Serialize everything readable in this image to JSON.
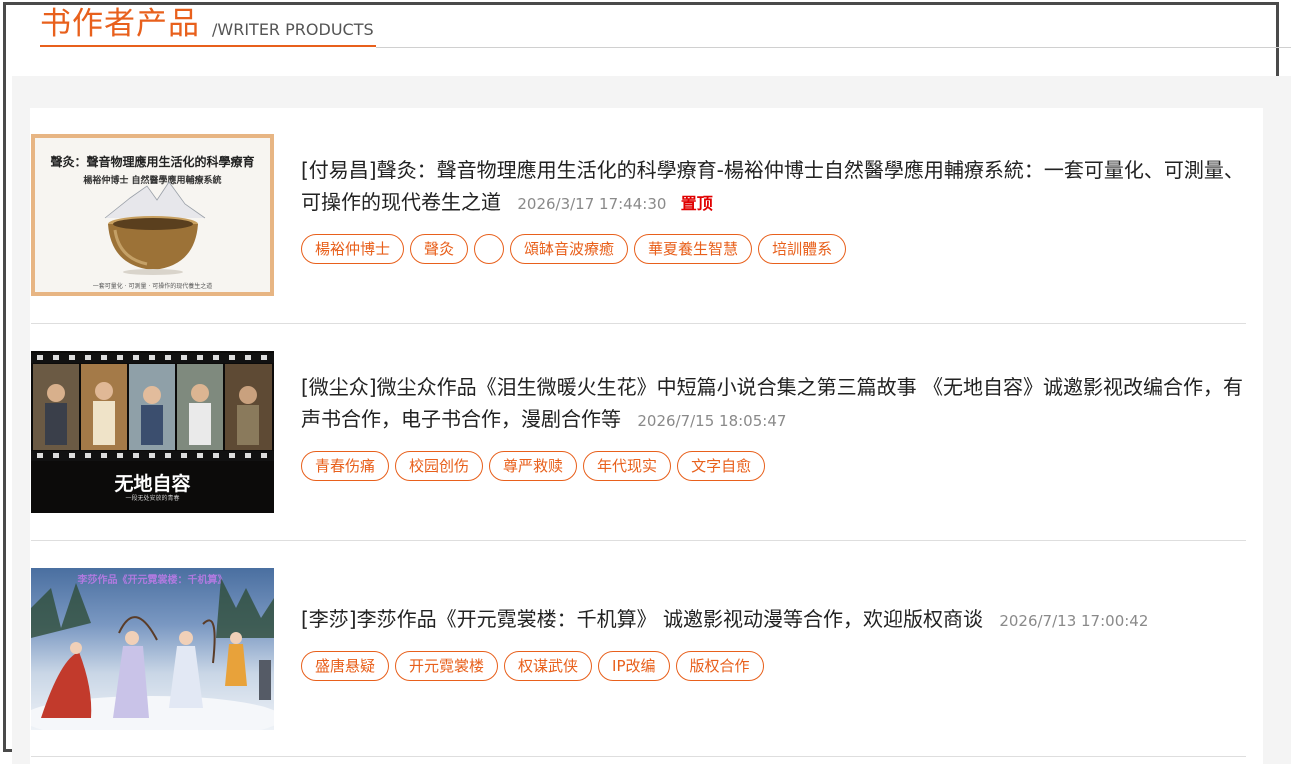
{
  "header": {
    "title_cn": "书作者产品",
    "title_en": "/WRITER PRODUCTS"
  },
  "colors": {
    "accent": "#e8601c",
    "pin": "#e00000"
  },
  "items": [
    {
      "author": "[付易昌]",
      "title": "聲灸：聲音物理應用生活化的科學療育-楊裕仲博士自然醫學應用輔療系統：一套可量化、可測量、可操作的现代卷生之道",
      "date": "2026/3/17 17:44:30",
      "pin": "置顶",
      "tags": [
        "楊裕仲博士",
        "聲灸",
        "",
        "頌缽音波療癒",
        "華夏養生智慧",
        "培訓體系"
      ],
      "thumb": {
        "line1": "聲灸：聲音物理應用生活化的科學療育",
        "line2": "楊裕仲博士 自然醫學應用輔療系統",
        "line3": "一套可量化 · 可測量 · 可操作的现代養生之道"
      }
    },
    {
      "author": "[微尘众]",
      "title": "微尘众作品《泪生微暖火生花》中短篇小说合集之第三篇故事 《无地自容》诚邀影视改编合作，有声书合作，电子书合作，漫剧合作等",
      "date": "2026/7/15 18:05:47",
      "tags": [
        "青春伤痛",
        "校园创伤",
        "尊严救赎",
        "年代现实",
        "文字自愈"
      ],
      "thumb": {
        "line1": "无地自容",
        "line2": "一段无处安放的青春"
      }
    },
    {
      "author": "[李莎]",
      "title": "李莎作品《开元霓裳楼：千机算》 诚邀影视动漫等合作，欢迎版权商谈",
      "date": "2026/7/13 17:00:42",
      "tags": [
        "盛唐悬疑",
        "开元霓裳楼",
        "权谋武侠",
        "IP改编",
        "版权合作"
      ],
      "thumb": {
        "line1": "李莎作品《开元霓裳楼：千机算》"
      }
    }
  ]
}
